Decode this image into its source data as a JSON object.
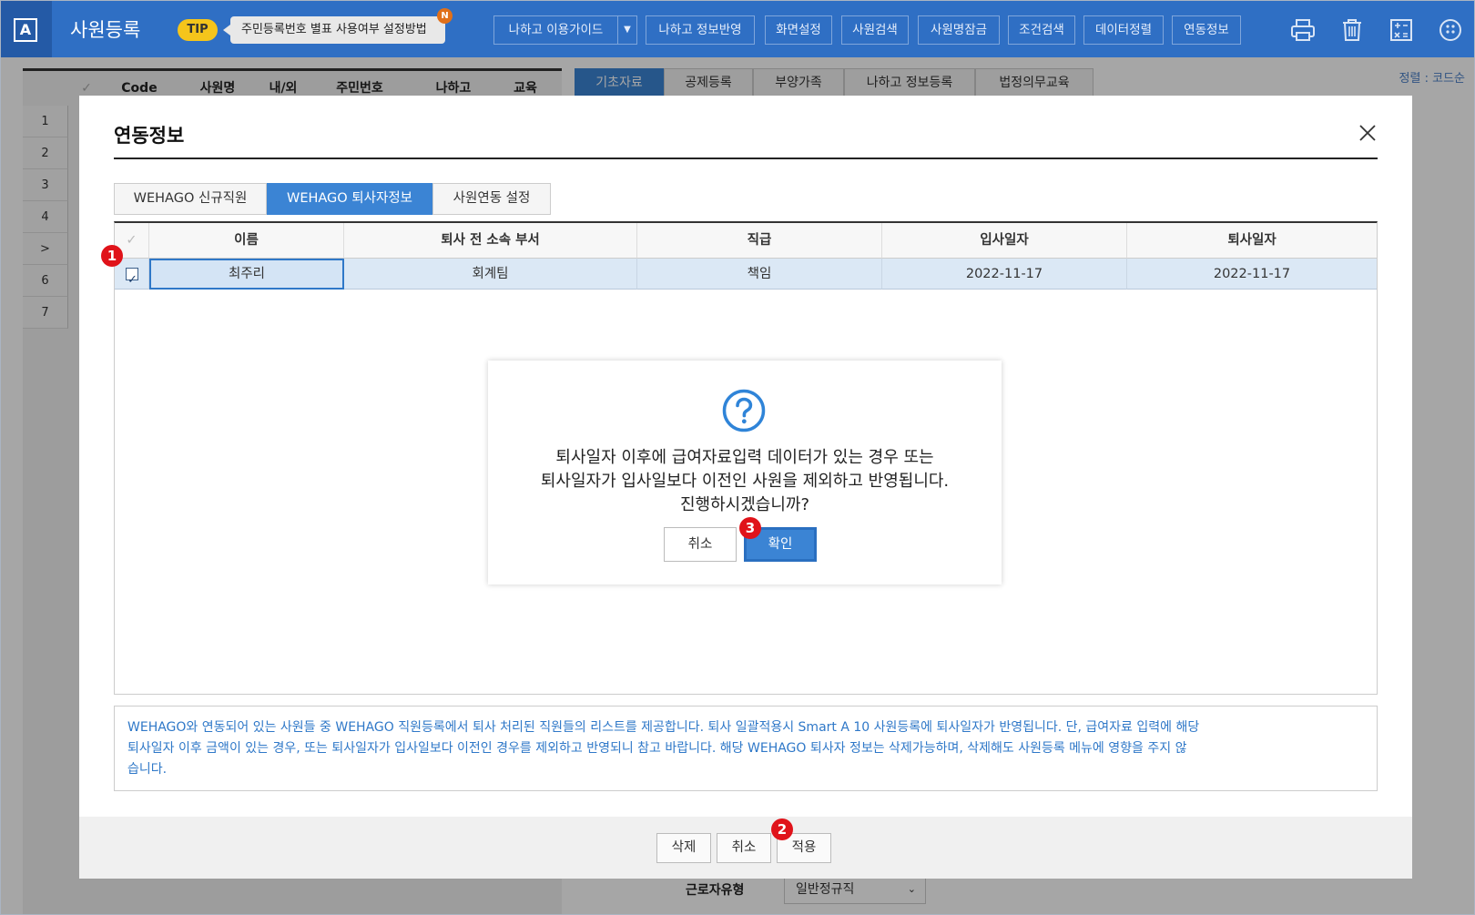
{
  "app": {
    "icon_letter": "A",
    "title": "사원등록",
    "tip_label": "TIP",
    "tip_text": "주민등록번호 별표 사용여부 설정방법",
    "tip_badge": "N"
  },
  "toolbar": {
    "buttons": [
      "나하고 이용가이드",
      "나하고 정보반영",
      "화면설정",
      "사원검색",
      "사원명잠금",
      "조건검색",
      "데이터정렬",
      "연동정보"
    ],
    "dropdown_arrow": "▼",
    "icons": [
      "print-icon",
      "trash-icon",
      "calculator-icon",
      "more-icon"
    ]
  },
  "background": {
    "sort_label": "정렬 : 코드순",
    "grid_headers": [
      "✓",
      "Code",
      "사원명",
      "내/외",
      "주민번호",
      "나하고",
      "교육"
    ],
    "row_numbers": [
      "1",
      "2",
      "3",
      "4",
      ">",
      "6",
      "7"
    ],
    "right_tabs": [
      "기초자료",
      "공제등록",
      "부양가족",
      "나하고 정보등록",
      "법정의무교육"
    ],
    "worker_type_label": "근로자유형",
    "worker_type_value": "일반정규직"
  },
  "dialog": {
    "title": "연동정보",
    "tabs": [
      "WEHAGO 신규직원",
      "WEHAGO 퇴사자정보",
      "사원연동 설정"
    ],
    "active_tab": 1,
    "table": {
      "header_check": "✓",
      "columns": [
        "이름",
        "퇴사 전 소속 부서",
        "직급",
        "입사일자",
        "퇴사일자"
      ],
      "rows": [
        {
          "checked": true,
          "cells": [
            "최주리",
            "회계팀",
            "책임",
            "2022-11-17",
            "2022-11-17"
          ]
        }
      ]
    },
    "note_lines": [
      "WEHAGO와 연동되어 있는 사원들 중 WEHAGO 직원등록에서 퇴사 처리된 직원들의 리스트를 제공합니다. 퇴사 일괄적용시 Smart A 10 사원등록에 퇴사일자가 반영됩니다. 단, 급여자료 입력에 해당",
      "퇴사일자 이후 금액이 있는 경우, 또는 퇴사일자가 입사일보다 이전인 경우를 제외하고 반영되니 참고 바랍니다. 해당 WEHAGO 퇴사자 정보는 삭제가능하며, 삭제해도 사원등록 메뉴에 영향을 주지 않",
      "습니다."
    ],
    "footer_buttons": {
      "delete": "삭제",
      "cancel": "취소",
      "apply": "적용"
    }
  },
  "confirm": {
    "message_lines": [
      "퇴사일자 이후에 급여자료입력 데이터가 있는 경우 또는",
      "퇴사일자가 입사일보다 이전인 사원을 제외하고 반영됩니다.",
      "진행하시겠습니까?"
    ],
    "cancel_label": "취소",
    "ok_label": "확인",
    "icon": "question-icon"
  },
  "markers": [
    "1",
    "2",
    "3"
  ],
  "colors": {
    "primary": "#2f6fc4",
    "accent": "#3b84d4",
    "marker": "#e0131a",
    "tip": "#f5c51b"
  }
}
